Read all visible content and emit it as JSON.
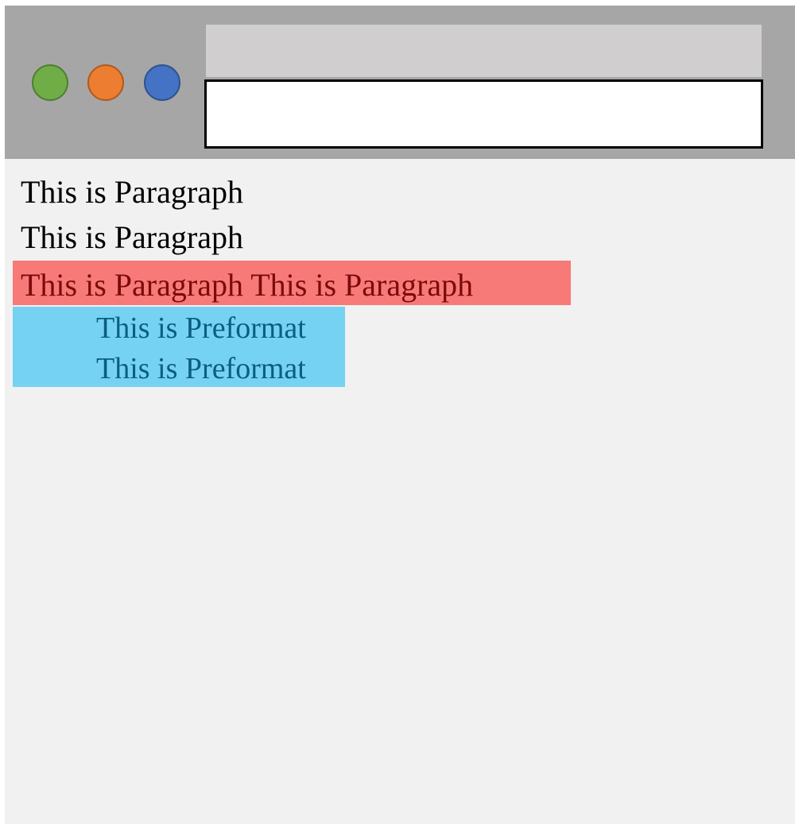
{
  "window": {
    "controls": [
      {
        "name": "green-circle-icon",
        "color": "#70ad47"
      },
      {
        "name": "orange-circle-icon",
        "color": "#ed7d31"
      },
      {
        "name": "blue-circle-icon",
        "color": "#4472c4"
      }
    ],
    "address_bar_value": ""
  },
  "content": {
    "paragraphs": [
      {
        "text": "This is Paragraph"
      },
      {
        "text": "This is Paragraph"
      },
      {
        "text": "This is Paragraph This is Paragraph",
        "highlight": "#f77a79",
        "text_color": "#7c0a0a"
      }
    ],
    "preformatted": {
      "lines": [
        "This is Preformat",
        "This is Preformat"
      ],
      "background": "#75d2f2",
      "text_color": "#0b5e80"
    }
  }
}
